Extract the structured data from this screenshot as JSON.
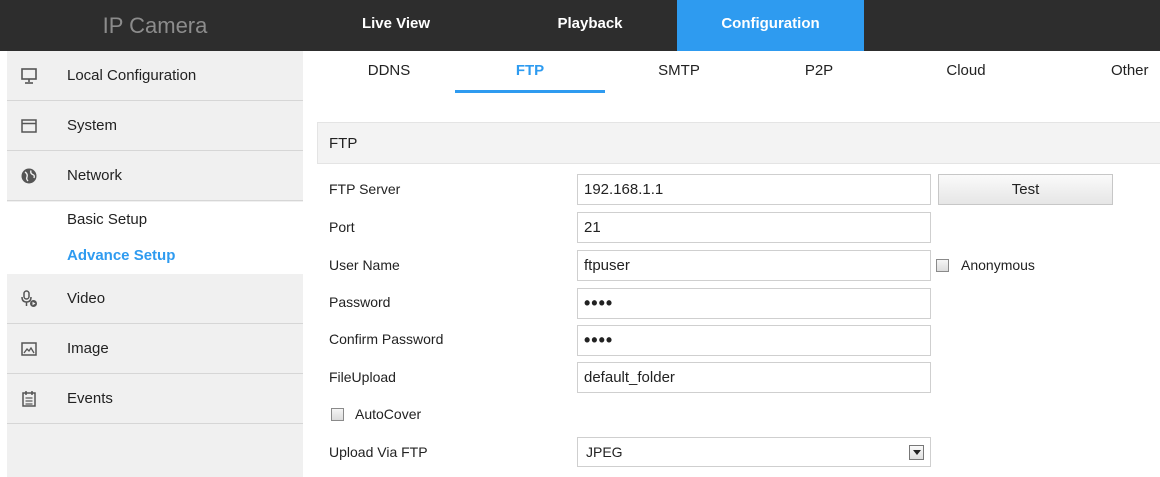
{
  "app": {
    "title": "IP Camera"
  },
  "topnav": {
    "live": "Live View",
    "playback": "Playback",
    "config": "Configuration"
  },
  "sidebar": {
    "items": [
      {
        "label": "Local Configuration",
        "icon": "monitor-icon"
      },
      {
        "label": "System",
        "icon": "window-icon"
      },
      {
        "label": "Network",
        "icon": "globe-icon"
      },
      {
        "label": "Video",
        "icon": "camera-mic-icon"
      },
      {
        "label": "Image",
        "icon": "image-icon"
      },
      {
        "label": "Events",
        "icon": "calendar-icon"
      }
    ],
    "sub": [
      {
        "label": "Basic Setup",
        "active": false
      },
      {
        "label": "Advance Setup",
        "active": true
      }
    ]
  },
  "tabs": [
    "DDNS",
    "FTP",
    "SMTP",
    "P2P",
    "Cloud",
    "Other"
  ],
  "section": {
    "title": "FTP"
  },
  "form": {
    "server_label": "FTP Server",
    "server_value": "192.168.1.1",
    "test_label": "Test",
    "port_label": "Port",
    "port_value": "21",
    "user_label": "User Name",
    "user_value": "ftpuser",
    "anonymous_label": "Anonymous",
    "password_label": "Password",
    "password_value": "••••",
    "confirm_label": "Confirm Password",
    "confirm_value": "••••",
    "fileupload_label": "FileUpload",
    "fileupload_value": "default_folder",
    "autocover_label": "AutoCover",
    "upload_label": "Upload Via FTP",
    "upload_value": "JPEG"
  },
  "colors": {
    "accent": "#2e9bf0",
    "topbar": "#2d2d2d",
    "sidebar": "#f0f0f0"
  }
}
